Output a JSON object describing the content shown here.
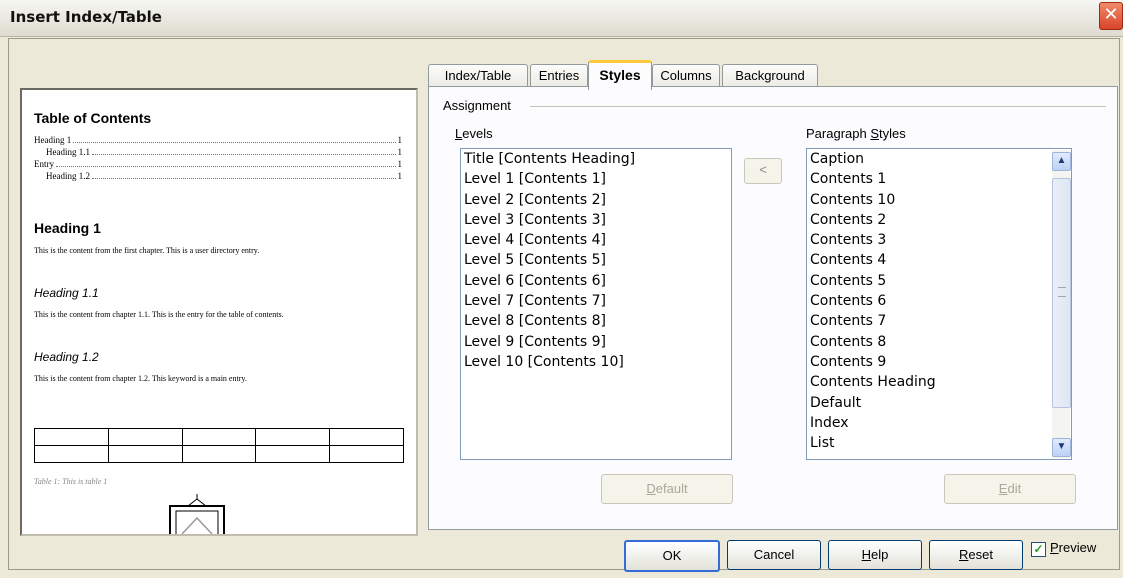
{
  "window": {
    "title": "Insert Index/Table",
    "close": "✕"
  },
  "tabs": [
    {
      "label": "Index/Table"
    },
    {
      "label": "Entries"
    },
    {
      "label": "Styles"
    },
    {
      "label": "Columns"
    },
    {
      "label": "Background"
    }
  ],
  "preview": {
    "toc_title": "Table of Contents",
    "toc_entries": [
      {
        "text": "Heading 1",
        "page": "1"
      },
      {
        "text": "Heading 1.1",
        "page": "1"
      },
      {
        "text": "Entry",
        "page": "1"
      },
      {
        "text": "Heading 1.2",
        "page": "1"
      }
    ],
    "heading1": "Heading 1",
    "body1": "This is the content from the first chapter. This is a user directory entry.",
    "heading11": "Heading 1.1",
    "body2": "This is the content from chapter 1.1. This is the entry for the table of contents.",
    "heading12": "Heading 1.2",
    "body3": "This is the content from chapter 1.2. This keyword is a main entry.",
    "table_caption": "Table 1: This is table 1"
  },
  "assignment": {
    "group_label": "Assignment",
    "levels_label": "Levels",
    "levels_mnemonic": "L",
    "levels_rest": "evels",
    "levels": [
      "Title [Contents Heading]",
      "Level 1 [Contents 1]",
      "Level 2 [Contents 2]",
      "Level 3 [Contents 3]",
      "Level 4 [Contents 4]",
      "Level 5 [Contents 5]",
      "Level 6 [Contents 6]",
      "Level 7 [Contents 7]",
      "Level 8 [Contents 8]",
      "Level 9 [Contents 9]",
      "Level 10 [Contents 10]"
    ],
    "assign_button": "<",
    "styles_label_pre": "Paragraph ",
    "styles_label_mn": "S",
    "styles_label_post": "tyles",
    "paragraph_styles": [
      "Caption",
      "Contents 1",
      "Contents 10",
      "Contents 2",
      "Contents 3",
      "Contents 4",
      "Contents 5",
      "Contents 6",
      "Contents 7",
      "Contents 8",
      "Contents 9",
      "Contents Heading",
      "Default",
      "Index",
      "List"
    ],
    "default_btn_mn": "D",
    "default_btn_rest": "efault",
    "edit_btn_mn": "E",
    "edit_btn_rest": "dit"
  },
  "buttons": {
    "ok": "OK",
    "cancel": "Cancel",
    "help_mn": "H",
    "help_rest": "elp",
    "reset_mn": "R",
    "reset_rest": "eset",
    "preview_mn": "P",
    "preview_rest": "review",
    "preview_checked": true,
    "check_mark": "✓"
  },
  "icons": {
    "scroll_up": "▲",
    "scroll_down": "▼"
  }
}
